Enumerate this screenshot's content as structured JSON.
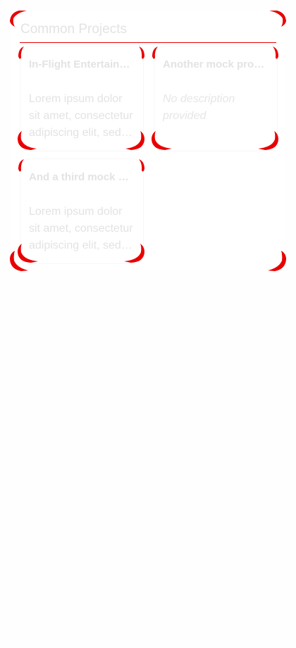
{
  "section": {
    "title": "Common Projects"
  },
  "projects": [
    {
      "title": "In-Flight Entertainment System Upgrade",
      "description": "Lorem ipsum dolor sit amet, consectetur adipiscing elit, sed do eiusmod tempor"
    },
    {
      "title": "Another mock project",
      "description": "No description provided"
    },
    {
      "title": "And a third mock project",
      "description": "Lorem ipsum dolor sit amet, consectetur adipiscing elit, sed do eiusmod tempor"
    }
  ],
  "colors": {
    "accent": "#e90000",
    "text": "#e3e3e3",
    "background": "#ffffff"
  }
}
